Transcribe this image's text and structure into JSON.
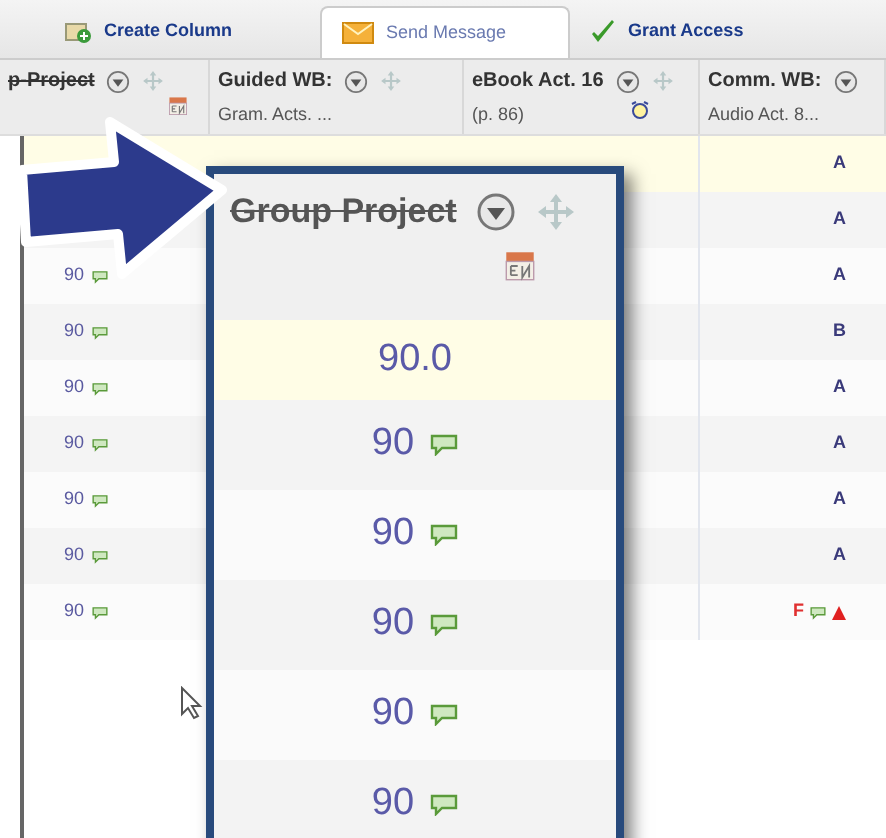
{
  "toolbar": {
    "tabs": [
      {
        "label": "Create Column",
        "selected": false
      },
      {
        "label": "Send Message",
        "selected": true
      },
      {
        "label": "Grant Access",
        "selected": false
      }
    ]
  },
  "columns": [
    {
      "title": "p-Project",
      "struck": true
    },
    {
      "title": "Guided WB:",
      "subtitle": "Gram. Acts. ...",
      "struck": false
    },
    {
      "title": "eBook Act. 16",
      "subtitle": "(p. 86)",
      "struck": false
    },
    {
      "title": "Comm. WB:",
      "subtitle": "Audio Act. 8...",
      "struck": false
    }
  ],
  "rows": [
    {
      "highlighted": true,
      "grade": "A",
      "grade_comment": false,
      "alert": false
    },
    {
      "highlighted": false,
      "grade": "A",
      "grade_comment": false,
      "alert": false
    },
    {
      "highlighted": false,
      "score": "90",
      "comment": true,
      "grade": "A",
      "grade_comment": false,
      "alert": false
    },
    {
      "highlighted": false,
      "score": "90",
      "comment": true,
      "grade": "B",
      "grade_comment": false,
      "alert": false
    },
    {
      "highlighted": false,
      "score": "90",
      "comment": true,
      "grade": "A",
      "grade_comment": false,
      "alert": false
    },
    {
      "highlighted": false,
      "score": "90",
      "comment": true,
      "grade": "A",
      "grade_comment": false,
      "alert": false
    },
    {
      "highlighted": false,
      "score": "90",
      "comment": true,
      "grade": "A",
      "grade_comment": false,
      "alert": false
    },
    {
      "highlighted": false,
      "score": "90",
      "comment": true,
      "grade": "A",
      "grade_comment": false,
      "alert": false
    },
    {
      "highlighted": false,
      "score": "90",
      "comment": true,
      "grade": "F",
      "grade_comment": true,
      "alert": true
    }
  ],
  "callout": {
    "title": "Group Project",
    "struck": true,
    "cells": [
      {
        "value": "90.0",
        "highlighted": true,
        "comment": false
      },
      {
        "value": "90",
        "highlighted": false,
        "comment": true
      },
      {
        "value": "90",
        "highlighted": false,
        "comment": true
      },
      {
        "value": "90",
        "highlighted": false,
        "comment": true
      },
      {
        "value": "90",
        "highlighted": false,
        "comment": true
      },
      {
        "value": "90",
        "highlighted": false,
        "comment": true
      }
    ]
  }
}
